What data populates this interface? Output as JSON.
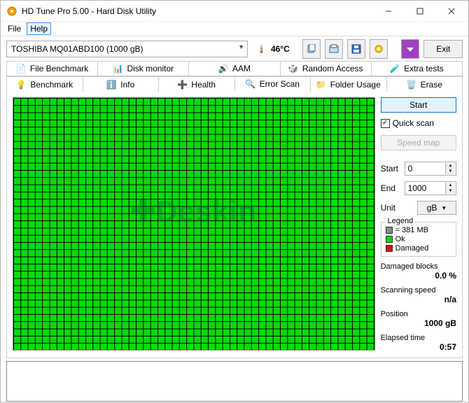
{
  "window": {
    "title": "HD Tune Pro 5.00 - Hard Disk Utility"
  },
  "menu": {
    "file": "File",
    "help": "Help"
  },
  "toolbar": {
    "drive": "TOSHIBA MQ01ABD100 (1000 gB)",
    "temp": "46°C",
    "exit": "Exit"
  },
  "tabs": {
    "row1": [
      "File Benchmark",
      "Disk monitor",
      "AAM",
      "Random Access",
      "Extra tests"
    ],
    "row2": [
      "Benchmark",
      "Info",
      "Health",
      "Error Scan",
      "Folder Usage",
      "Erase"
    ]
  },
  "side": {
    "start": "Start",
    "quickscan": "Quick scan",
    "speedmap": "Speed map",
    "start_label": "Start",
    "start_val": "0",
    "end_label": "End",
    "end_val": "1000",
    "unit_label": "Unit",
    "unit_val": "gB",
    "legend_title": "Legend",
    "legend_block": "= 381 MB",
    "legend_ok": "Ok",
    "legend_dmg": "Damaged",
    "damaged_label": "Damaged blocks",
    "damaged_val": "0.0 %",
    "speed_label": "Scanning speed",
    "speed_val": "n/a",
    "pos_label": "Position",
    "pos_val": "1000 gB",
    "time_label": "Elapsed time",
    "time_val": "0:57"
  }
}
